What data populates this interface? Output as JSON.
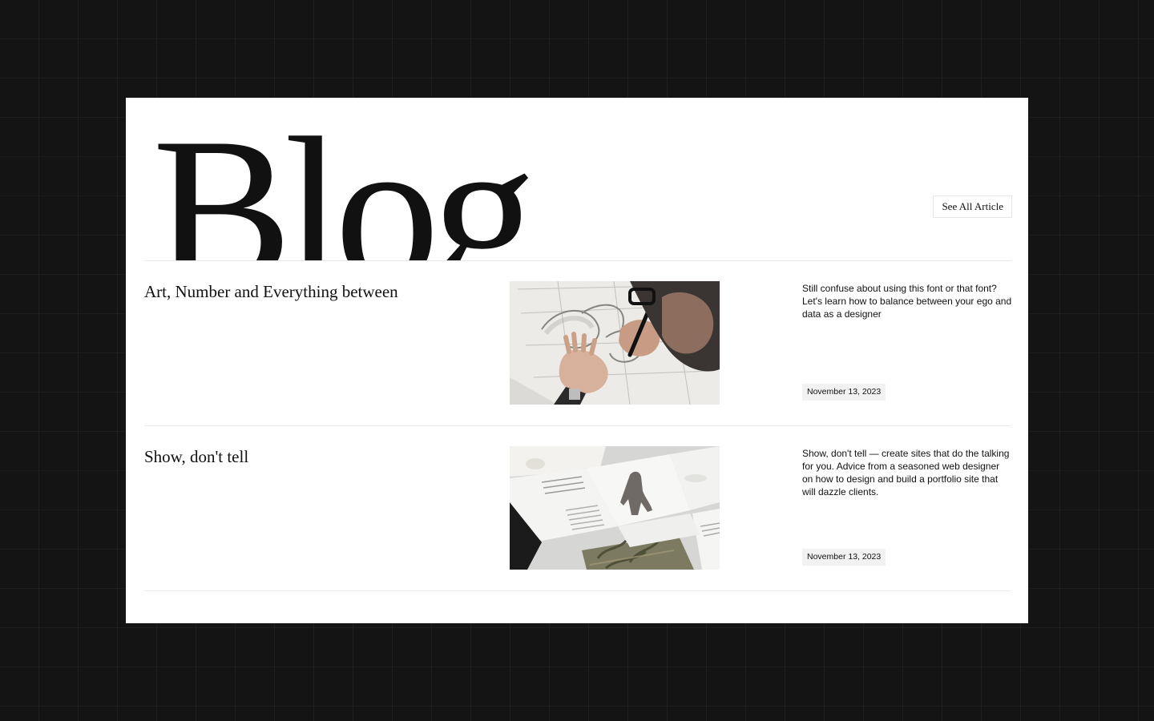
{
  "page": {
    "background_color": "#141414",
    "card_color": "#ffffff"
  },
  "header": {
    "title": "Blog",
    "see_all_label": "See All Article"
  },
  "articles": [
    {
      "title": "Art, Number and Everything between",
      "excerpt": "Still confuse about using this font or that font? Let's learn how to balance between your ego and data as a designer",
      "date": "November 13, 2023",
      "image_alt": "Designer sketching letterforms with a marker"
    },
    {
      "title": "Show, don't tell",
      "excerpt": "Show, don't tell — create sites that do the talking for you. Advice from a seasoned web designer on how to design and build a portfolio site that will dazzle clients.",
      "date": "November 13, 2023",
      "image_alt": "Printed portfolio pages laid out on a table"
    }
  ]
}
